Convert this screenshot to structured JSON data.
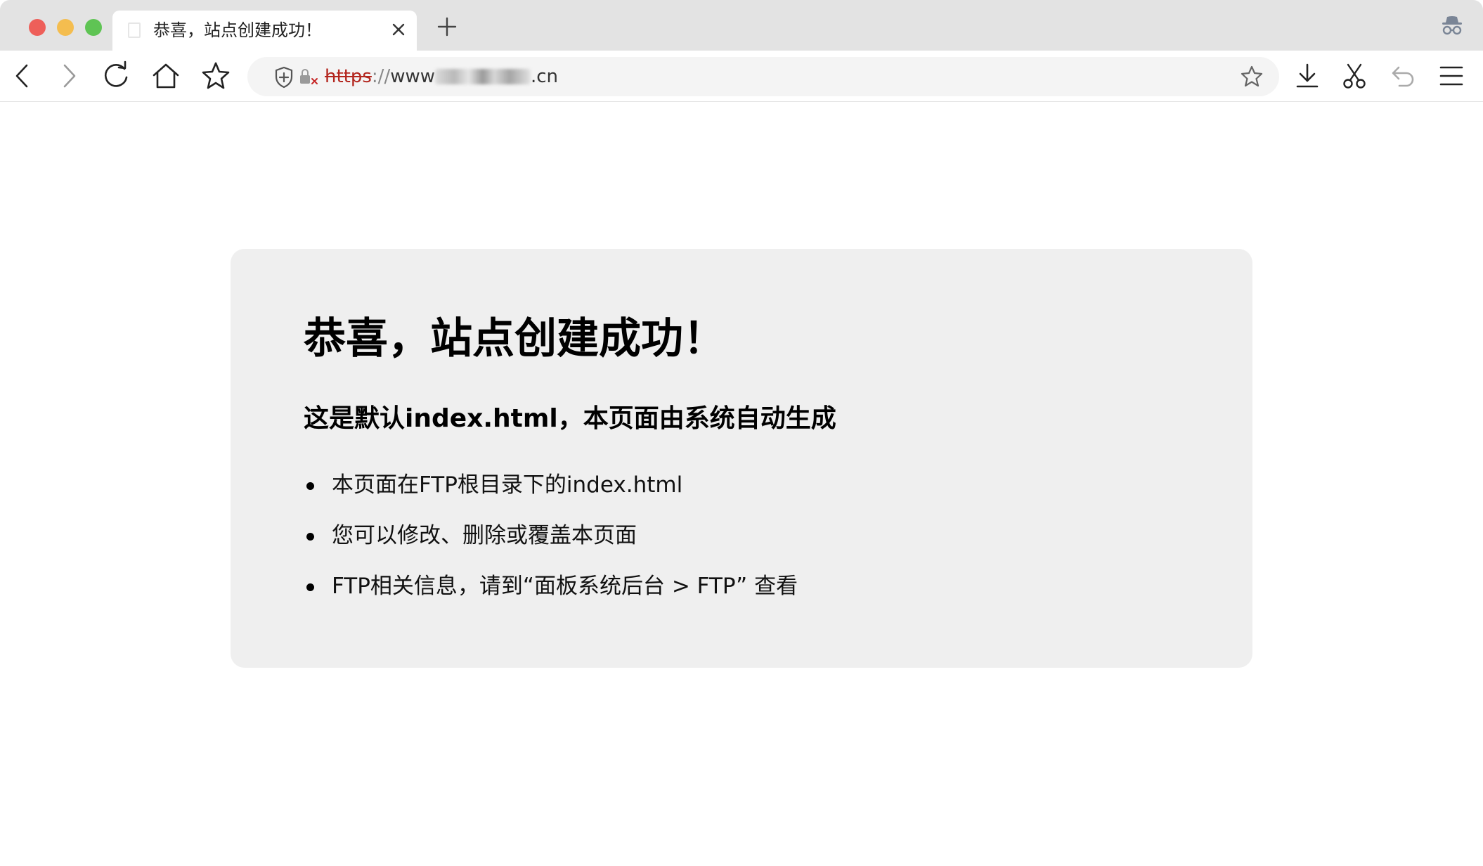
{
  "tab": {
    "title": "恭喜，站点创建成功！",
    "close_icon": "close-icon",
    "new_tab_icon": "plus-icon"
  },
  "toolbar": {
    "icons": [
      "back-icon",
      "forward-icon",
      "reload-icon",
      "home-icon",
      "bookmark-star-icon",
      "download-icon",
      "scissors-icon",
      "undo-icon",
      "menu-icon"
    ]
  },
  "address_bar": {
    "scheme": "https",
    "separator": "://",
    "host_prefix": "www",
    "host_suffix": ".cn",
    "security_icons": [
      "shield-icon",
      "insecure-lock-icon"
    ]
  },
  "page": {
    "title": "恭喜，站点创建成功！",
    "subtitle": "这是默认index.html，本页面由系统自动生成",
    "items": [
      "本页面在FTP根目录下的index.html",
      "您可以修改、删除或覆盖本页面",
      "FTP相关信息，请到“面板系统后台 > FTP” 查看"
    ]
  },
  "colors": {
    "tabbar_bg": "#e3e3e3",
    "card_bg": "#efefef",
    "insecure_scheme": "#b3261e",
    "close_button": "#ee5f59",
    "minimize_button": "#f4bd4f",
    "maximize_button": "#5fc454"
  }
}
